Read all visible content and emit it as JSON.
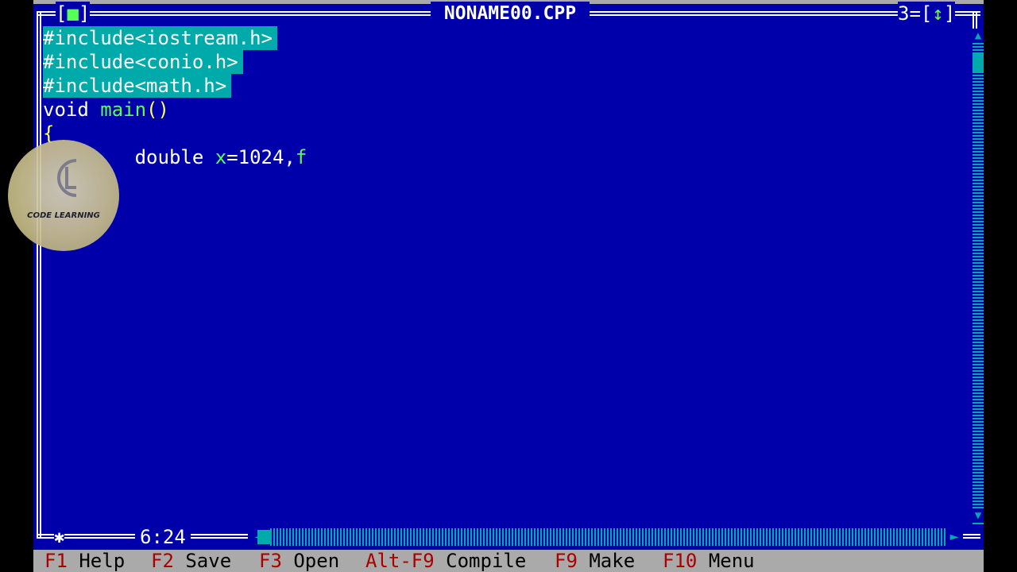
{
  "window": {
    "title": "NONAME00.CPP",
    "close_box_open": "[",
    "close_box_glyph": "■",
    "close_box_close": "]",
    "window_number": "3",
    "zoom_open": "=[",
    "zoom_glyph": "↕",
    "zoom_close": "]"
  },
  "editor": {
    "lines": [
      {
        "text": "#include<iostream.h>",
        "selected": true
      },
      {
        "text": "#include<conio.h>",
        "selected": true
      },
      {
        "text": "#include<math.h>",
        "selected": true
      },
      {
        "tokens": [
          {
            "t": "void ",
            "c": "white"
          },
          {
            "t": "main",
            "c": "green"
          },
          {
            "t": "()",
            "c": "yellow"
          }
        ]
      },
      {
        "tokens": [
          {
            "t": "{",
            "c": "yellow"
          }
        ]
      },
      {
        "tokens": [
          {
            "t": "        double ",
            "c": "white"
          },
          {
            "t": "x",
            "c": "green"
          },
          {
            "t": "=",
            "c": "white"
          },
          {
            "t": "1024",
            "c": "white"
          },
          {
            "t": ",",
            "c": "white"
          },
          {
            "t": "f",
            "c": "green"
          }
        ]
      }
    ]
  },
  "cursor_position": "6:24",
  "statusbar": {
    "items": [
      {
        "key": "F1",
        "label": "Help"
      },
      {
        "key": "F2",
        "label": "Save"
      },
      {
        "key": "F3",
        "label": "Open"
      },
      {
        "key": "Alt-F9",
        "label": "Compile"
      },
      {
        "key": "F9",
        "label": "Make"
      },
      {
        "key": "F10",
        "label": "Menu"
      }
    ]
  },
  "watermark": {
    "text": "CODE LEARNING"
  },
  "icons": {
    "resize": "✱",
    "scroll_up": "▲",
    "scroll_down": "▼",
    "scroll_left": "◄",
    "scroll_right": "►"
  },
  "colors": {
    "background": "#0000aa",
    "selection": "#00aaaa",
    "status_bar": "#aaaaaa",
    "hotkey": "#aa0000",
    "identifier": "#55ff55",
    "punctuation": "#ffff55"
  }
}
